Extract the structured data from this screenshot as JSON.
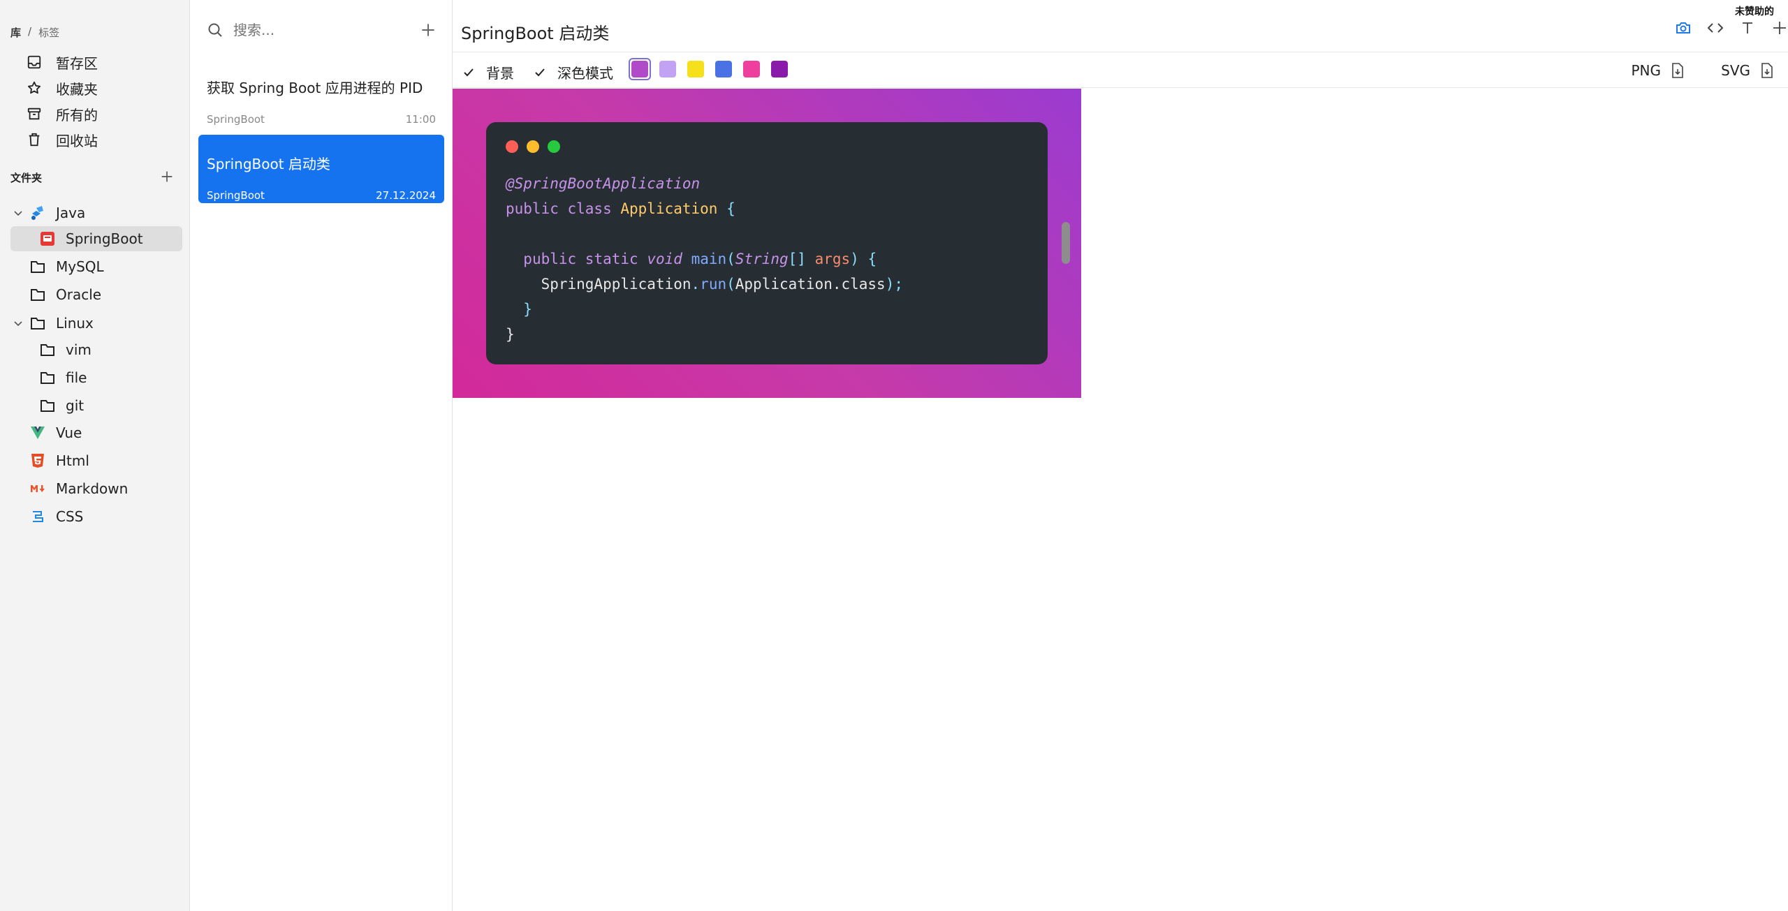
{
  "sidebar": {
    "breadcrumb": {
      "root": "库",
      "separator": "/",
      "sub": "标签"
    },
    "library": [
      {
        "label": "暂存区",
        "icon": "inbox-icon"
      },
      {
        "label": "收藏夹",
        "icon": "star-icon"
      },
      {
        "label": "所有的",
        "icon": "archive-icon"
      },
      {
        "label": "回收站",
        "icon": "trash-icon"
      }
    ],
    "folders_title": "文件夹",
    "folders": [
      {
        "label": "Java",
        "icon": "java-icon",
        "expanded": true
      },
      {
        "label": "SpringBoot",
        "icon": "springboot-icon",
        "selected": true
      },
      {
        "label": "MySQL",
        "icon": "folder-icon"
      },
      {
        "label": "Oracle",
        "icon": "folder-icon"
      },
      {
        "label": "Linux",
        "icon": "folder-icon",
        "expanded": true
      },
      {
        "label": "vim",
        "icon": "folder-icon"
      },
      {
        "label": "file",
        "icon": "folder-icon"
      },
      {
        "label": "git",
        "icon": "folder-icon"
      },
      {
        "label": "Vue",
        "icon": "vue-icon"
      },
      {
        "label": "Html",
        "icon": "html5-icon"
      },
      {
        "label": "Markdown",
        "icon": "markdown-icon"
      },
      {
        "label": "CSS",
        "icon": "css-icon"
      }
    ]
  },
  "notes": {
    "search_placeholder": "搜索...",
    "items": [
      {
        "title": "获取 Spring Boot 应用进程的 PID",
        "folder": "SpringBoot",
        "date": "11:00"
      },
      {
        "title": "SpringBoot 启动类",
        "folder": "SpringBoot",
        "date": "27.12.2024",
        "active": true
      }
    ]
  },
  "main": {
    "title": "SpringBoot 启动类",
    "badge": "未赞助的",
    "toolbar": {
      "background_label": "背景",
      "dark_mode_label": "深色模式",
      "swatches": [
        "#b04ac8",
        "#c2a2f2",
        "#f6e01b",
        "#4a72e5",
        "#ee3e9e",
        "#8a1aa9"
      ],
      "png_label": "PNG",
      "svg_label": "SVG"
    },
    "code": {
      "line1_annotation": "@SpringBootApplication",
      "line2": {
        "kw": "public class",
        "cls": "Application",
        "brace": "{"
      },
      "line4": {
        "kw": "public static",
        "void": "void",
        "fn": "main",
        "open": "(",
        "type": "String",
        "arr": "[]",
        "arg": "args",
        "close": ")",
        "brace": "{"
      },
      "line5": {
        "obj": "SpringApplication",
        "dot": ".",
        "fn": "run",
        "open": "(",
        "arg": "Application.class",
        "close": ");"
      },
      "line6": "}",
      "line7": "}"
    }
  },
  "colors": {
    "accent": "#1673f0",
    "gradient_start": "#d3299a",
    "gradient_end": "#9b3bd0",
    "code_bg": "#272e33",
    "dot_red": "#ff5f56",
    "dot_yellow": "#ffbd2e",
    "dot_green": "#27c93f"
  }
}
